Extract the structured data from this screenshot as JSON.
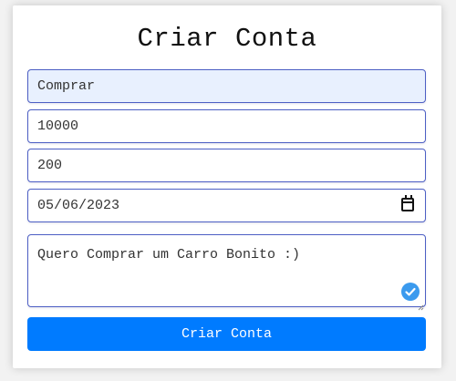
{
  "form": {
    "title": "Criar Conta",
    "name_value": "Comprar",
    "amount_value": "10000",
    "installment_value": "200",
    "date_value": "05/06/2023",
    "description_value": "Quero Comprar um Carro Bonito :)",
    "submit_label": "Criar Conta"
  },
  "colors": {
    "accent": "#007bff",
    "field_border": "#4d5fc4",
    "autofill_bg": "#e8f0fe",
    "check_badge": "#3b9aee"
  },
  "icons": {
    "date_picker": "calendar-icon",
    "textarea_badge": "check-circle-icon",
    "textarea_resize": "resize-handle-icon"
  }
}
